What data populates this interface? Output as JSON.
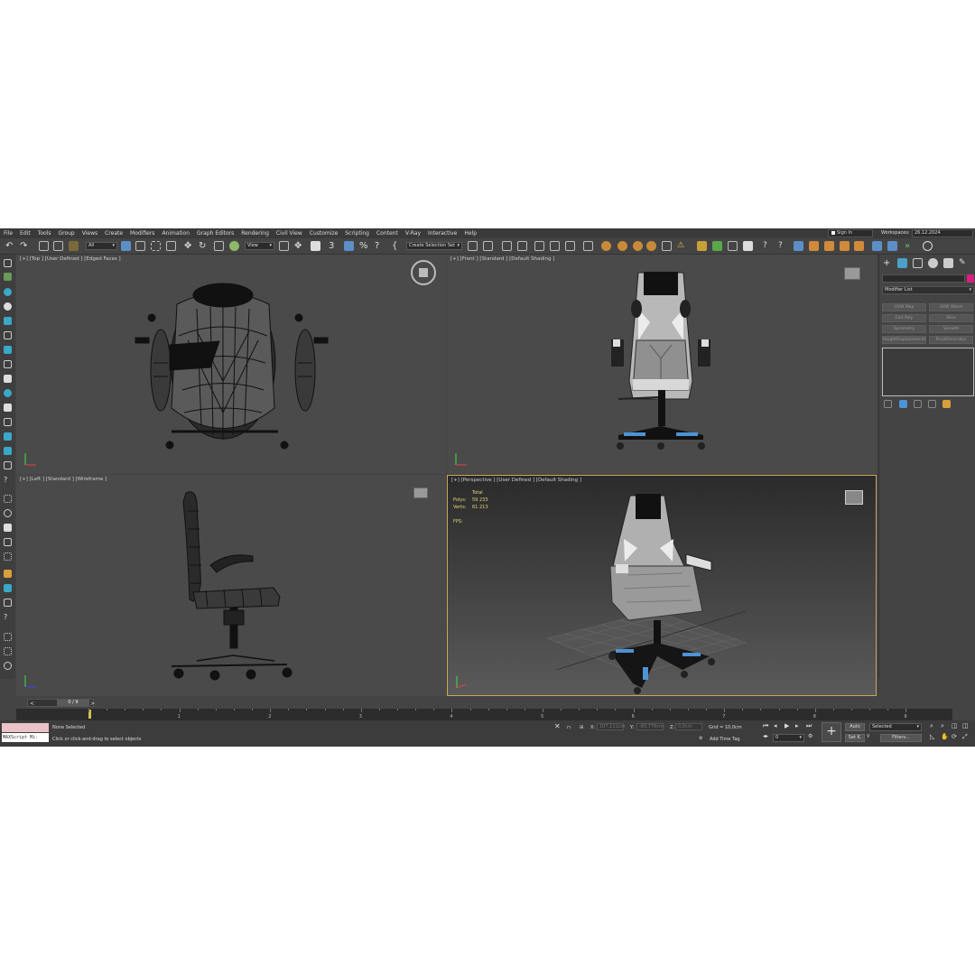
{
  "menu": [
    "File",
    "Edit",
    "Tools",
    "Group",
    "Views",
    "Create",
    "Modifiers",
    "Animation",
    "Graph Editors",
    "Rendering",
    "Civil View",
    "Customize",
    "Scripting",
    "Content",
    "V-Ray",
    "Interactive",
    "Help"
  ],
  "signin": "Sign In",
  "workspaces_label": "Workspaces:",
  "workspaces_value": "26.12.2024",
  "toolbar": {
    "filter": "All",
    "refcoord": "View",
    "selection_set": "Create Selection Set"
  },
  "viewports": {
    "top": {
      "label": "[+] [Top ] [User Defined ] [Edged Faces ]"
    },
    "front": {
      "label": "[+] [Front ] [Standard ] [Default Shading ]"
    },
    "left": {
      "label": "[+] [Left ] [Standard ] [Wireframe ]"
    },
    "perspective": {
      "label": "[+] [Perspective ] [User Defined ] [Default Shading ]",
      "stats_total": "Total",
      "polys_label": "Polys:",
      "polys_value": "59 233",
      "verts_label": "Verts:",
      "verts_value": "61 213",
      "fps_label": "FPS:"
    }
  },
  "command_panel": {
    "modifier_list": "Modifier List",
    "modifiers": [
      "UVW Map",
      "UVW Xform",
      "Edit Poly",
      "Slice",
      "Symmetry",
      "Smooth",
      "HeightDisplacementM",
      "PivotGenerator"
    ]
  },
  "timeline": {
    "frame_label": "0 / 9",
    "frame_numbers": [
      "0",
      "1",
      "2",
      "3",
      "4",
      "5",
      "6",
      "7",
      "8",
      "9"
    ],
    "current_frame_pct": 0
  },
  "status": {
    "maxscript": "MAXScript Mi:",
    "selection": "None Selected",
    "prompt": "Click or click-and-drag to select objects",
    "x_label": "X:",
    "x_value": "107,111cm",
    "y_label": "Y:",
    "y_value": "-60,776cm",
    "z_label": "Z:",
    "z_value": "0,0cm",
    "grid": "Grid = 10,0cm",
    "add_time_tag": "Add Time Tag",
    "frame_field": "0",
    "auto": "Auto",
    "set_k": "Set K.",
    "selected": "Selected",
    "filters": "Filters..."
  },
  "colors": {
    "app_bg": "#444444",
    "viewport_bg": "#4a4a4a",
    "accent_blue": "#4d93d6",
    "active_border": "#c8a85a",
    "key_marker": "#d8c248",
    "object_color": "#d91f7e"
  }
}
